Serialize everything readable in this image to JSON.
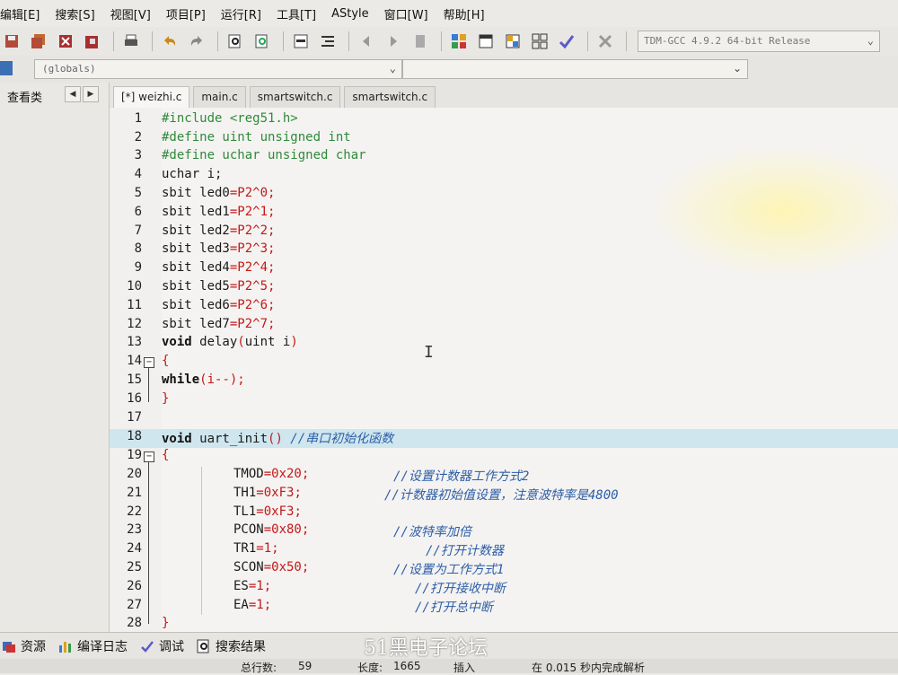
{
  "menu": [
    "编辑[E]",
    "搜索[S]",
    "视图[V]",
    "项目[P]",
    "运行[R]",
    "工具[T]",
    "AStyle",
    "窗口[W]",
    "帮助[H]"
  ],
  "toolbar": {
    "compiler": "TDM-GCC 4.9.2 64-bit Release"
  },
  "classbar": {
    "scope": "(globals)",
    "members": ""
  },
  "leftpanel": {
    "title": "查看类"
  },
  "tabs": [
    "[*] weizhi.c",
    "main.c",
    "smartswitch.c",
    "smartswitch.c"
  ],
  "editor": {
    "lines": [
      {
        "n": "1"
      },
      {
        "n": "2"
      },
      {
        "n": "3"
      },
      {
        "n": "4"
      },
      {
        "n": "5"
      },
      {
        "n": "6"
      },
      {
        "n": "7"
      },
      {
        "n": "8"
      },
      {
        "n": "9"
      },
      {
        "n": "10"
      },
      {
        "n": "11"
      },
      {
        "n": "12"
      },
      {
        "n": "13"
      },
      {
        "n": "14"
      },
      {
        "n": "15"
      },
      {
        "n": "16"
      },
      {
        "n": "17"
      },
      {
        "n": "18"
      },
      {
        "n": "19"
      },
      {
        "n": "20"
      },
      {
        "n": "21"
      },
      {
        "n": "22"
      },
      {
        "n": "23"
      },
      {
        "n": "24"
      },
      {
        "n": "25"
      },
      {
        "n": "26"
      },
      {
        "n": "27"
      },
      {
        "n": "28"
      }
    ],
    "code": {
      "l1": "#include <reg51.h>",
      "l2": "#define uint unsigned int",
      "l3": "#define uchar unsigned char",
      "l4": "uchar i;",
      "l5_a": "sbit led0",
      "l5_b": "=P2^",
      "l5_c": "0",
      "l5_d": ";",
      "l6_a": "sbit led1",
      "l6_c": "1",
      "l7_a": "sbit led2",
      "l7_c": "2",
      "l8_a": "sbit led3",
      "l8_c": "3",
      "l9_a": "sbit led4",
      "l9_c": "4",
      "l10_a": "sbit led5",
      "l10_c": "5",
      "l11_a": "sbit led6",
      "l11_c": "6",
      "l12_a": "sbit led7",
      "l12_c": "7",
      "l13_kw": "void",
      "l13_rest": " delay",
      "l13_p": "(",
      "l13_args": "uint i",
      "l13_p2": ")",
      "l14": "{",
      "l15_kw": "while",
      "l15_rest": "(i--);",
      "l16": "}",
      "l18_kw": "void",
      "l18_rest": " uart_init",
      "l18_p": "()",
      "l18_cm": " //串口初始化函数",
      "l19": "{",
      "l20_a": "TMOD",
      "l20_b": "=0x20;",
      "l20_cm": "//设置计数器工作方式2",
      "l21_a": "TH1",
      "l21_b": "=0xF3;",
      "l21_cm": "//计数器初始值设置，注意波特率是4800",
      "l22_a": "TL1",
      "l22_b": "=0xF3;",
      "l23_a": "PCON",
      "l23_b": "=0x80;",
      "l23_cm": "//波特率加倍",
      "l24_a": "TR1",
      "l24_b": "=1;",
      "l24_cm": "//打开计数器",
      "l25_a": "SCON",
      "l25_b": "=0x50;",
      "l25_cm": "//设置为工作方式1",
      "l26_a": "ES",
      "l26_b": "=1;",
      "l26_cm": "//打开接收中断",
      "l27_a": "EA",
      "l27_b": "=1;",
      "l27_cm": "//打开总中断",
      "l28": "}"
    }
  },
  "bottom_tabs": [
    "资源",
    "编译日志",
    "调试",
    "搜索结果"
  ],
  "watermark": "51黑电子论坛",
  "status": {
    "total_lines_label": "总行数:",
    "total_lines": "59",
    "length_label": "长度:",
    "length": "1665",
    "mode": "插入",
    "parse": "在 0.015 秒内完成解析"
  },
  "colors": {
    "preprocessor": "#2f8a3a",
    "number": "#c41818",
    "comment": "#2d5ea8",
    "highlight_line": "#cfe6ee"
  }
}
